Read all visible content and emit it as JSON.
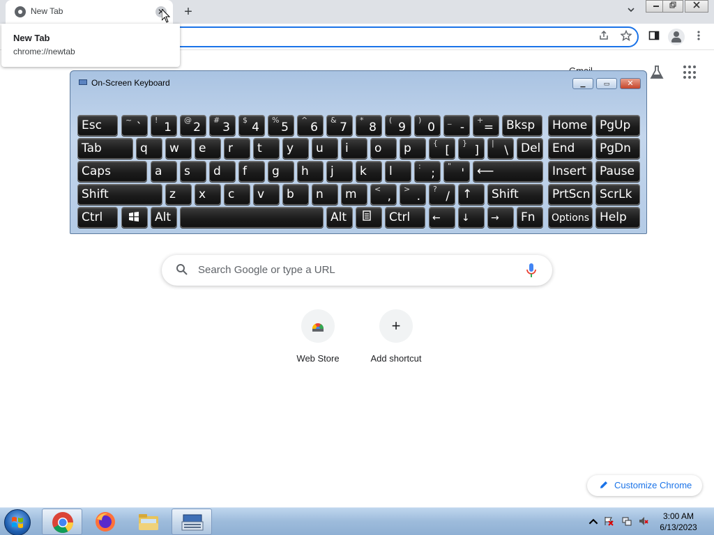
{
  "browser": {
    "tab_title": "New Tab",
    "hover_card": {
      "title": "New Tab",
      "url": "chrome://newtab"
    },
    "close_glyph": "✕",
    "new_tab_glyph": "+"
  },
  "ntp": {
    "gmail_link": "Gmail",
    "search_placeholder": "Search Google or type a URL",
    "shortcuts": [
      {
        "label": "Web Store",
        "icon": "web-store-icon"
      },
      {
        "label": "Add shortcut",
        "icon": "plus-icon",
        "glyph": "+"
      }
    ],
    "customize_label": "Customize Chrome"
  },
  "osk": {
    "title": "On-Screen Keyboard",
    "rows": [
      [
        {
          "word": "Esc"
        },
        {
          "shift": "~",
          "lower": "`"
        },
        {
          "shift": "!",
          "lower": "1"
        },
        {
          "shift": "@",
          "lower": "2"
        },
        {
          "shift": "#",
          "lower": "3"
        },
        {
          "shift": "$",
          "lower": "4"
        },
        {
          "shift": "%",
          "lower": "5"
        },
        {
          "shift": "^",
          "lower": "6"
        },
        {
          "shift": "&",
          "lower": "7"
        },
        {
          "shift": "*",
          "lower": "8"
        },
        {
          "shift": "(",
          "lower": "9"
        },
        {
          "shift": ")",
          "lower": "0"
        },
        {
          "shift": "_",
          "lower": "-"
        },
        {
          "shift": "+",
          "lower": "="
        },
        {
          "word": "Bksp"
        },
        {
          "word": "Home"
        },
        {
          "word": "PgUp"
        }
      ],
      [
        {
          "word": "Tab"
        },
        {
          "word": "q"
        },
        {
          "word": "w"
        },
        {
          "word": "e"
        },
        {
          "word": "r"
        },
        {
          "word": "t"
        },
        {
          "word": "y"
        },
        {
          "word": "u"
        },
        {
          "word": "i"
        },
        {
          "word": "o"
        },
        {
          "word": "p"
        },
        {
          "shift": "{",
          "lower": "["
        },
        {
          "shift": "}",
          "lower": "]"
        },
        {
          "shift": "|",
          "lower": "\\"
        },
        {
          "word": "Del"
        },
        {
          "word": "End"
        },
        {
          "word": "PgDn"
        }
      ],
      [
        {
          "word": "Caps"
        },
        {
          "word": "a"
        },
        {
          "word": "s"
        },
        {
          "word": "d"
        },
        {
          "word": "f"
        },
        {
          "word": "g"
        },
        {
          "word": "h"
        },
        {
          "word": "j"
        },
        {
          "word": "k"
        },
        {
          "word": "l"
        },
        {
          "shift": ":",
          "lower": ";"
        },
        {
          "shift": "\"",
          "lower": "'"
        },
        {
          "word": "⟵"
        },
        {
          "word": "Insert"
        },
        {
          "word": "Pause"
        }
      ],
      [
        {
          "word": "Shift"
        },
        {
          "word": "z"
        },
        {
          "word": "x"
        },
        {
          "word": "c"
        },
        {
          "word": "v"
        },
        {
          "word": "b"
        },
        {
          "word": "n"
        },
        {
          "word": "m"
        },
        {
          "shift": "<",
          "lower": ","
        },
        {
          "shift": ">",
          "lower": "."
        },
        {
          "shift": "?",
          "lower": "/"
        },
        {
          "word": "↑"
        },
        {
          "word": "Shift"
        },
        {
          "word": "PrtScn"
        },
        {
          "word": "ScrLk"
        }
      ],
      [
        {
          "word": "Ctrl"
        },
        {
          "icon": "windows-icon"
        },
        {
          "word": "Alt"
        },
        {
          "word": ""
        },
        {
          "word": "Alt"
        },
        {
          "icon": "menu-key-icon"
        },
        {
          "word": "Ctrl"
        },
        {
          "small": "←"
        },
        {
          "small": "↓"
        },
        {
          "small": "→"
        },
        {
          "word": "Fn"
        },
        {
          "small": "Options"
        },
        {
          "word": "Help"
        }
      ]
    ]
  },
  "taskbar": {
    "time": "3:00 AM",
    "date": "6/13/2023",
    "apps": [
      "chrome-icon",
      "firefox-icon",
      "file-explorer-icon",
      "on-screen-keyboard-icon"
    ]
  },
  "colors": {
    "accent": "#1a73e8",
    "tab_strip": "#dee1e6",
    "key_face": "#1c1c1c"
  }
}
